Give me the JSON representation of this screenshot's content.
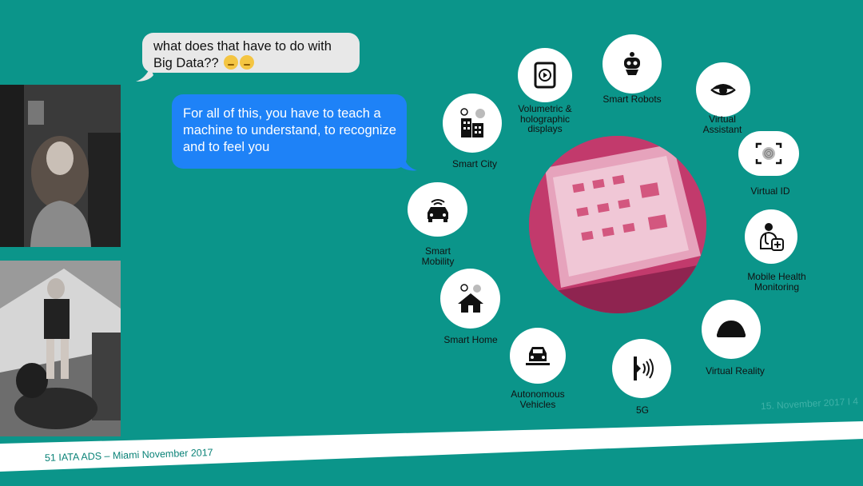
{
  "chat": {
    "question": "what does that have to do with Big Data??",
    "answer": "For all of this, you have to teach a machine to understand, to recognize and to feel you"
  },
  "topics": {
    "volumetric": "Volumetric & holographic displays",
    "smart_robots": "Smart Robots",
    "virtual_assistant": "Virtual Assistant",
    "smart_city": "Smart City",
    "virtual_id": "Virtual ID",
    "smart_mobility": "Smart Mobility",
    "mobile_health": "Mobile Health Monitoring",
    "smart_home": "Smart Home",
    "virtual_reality": "Virtual Reality",
    "autonomous_vehicles": "Autonomous Vehicles",
    "five_g": "5G"
  },
  "footer": {
    "text": "51 IATA ADS – Miami November 2017",
    "faint_date": "15. November 2017 I 4"
  },
  "colors": {
    "background": "#0b958a",
    "bubble_grey": "#e8e8e8",
    "bubble_blue": "#1e82f7",
    "center_magenta": "#c23a6c"
  }
}
